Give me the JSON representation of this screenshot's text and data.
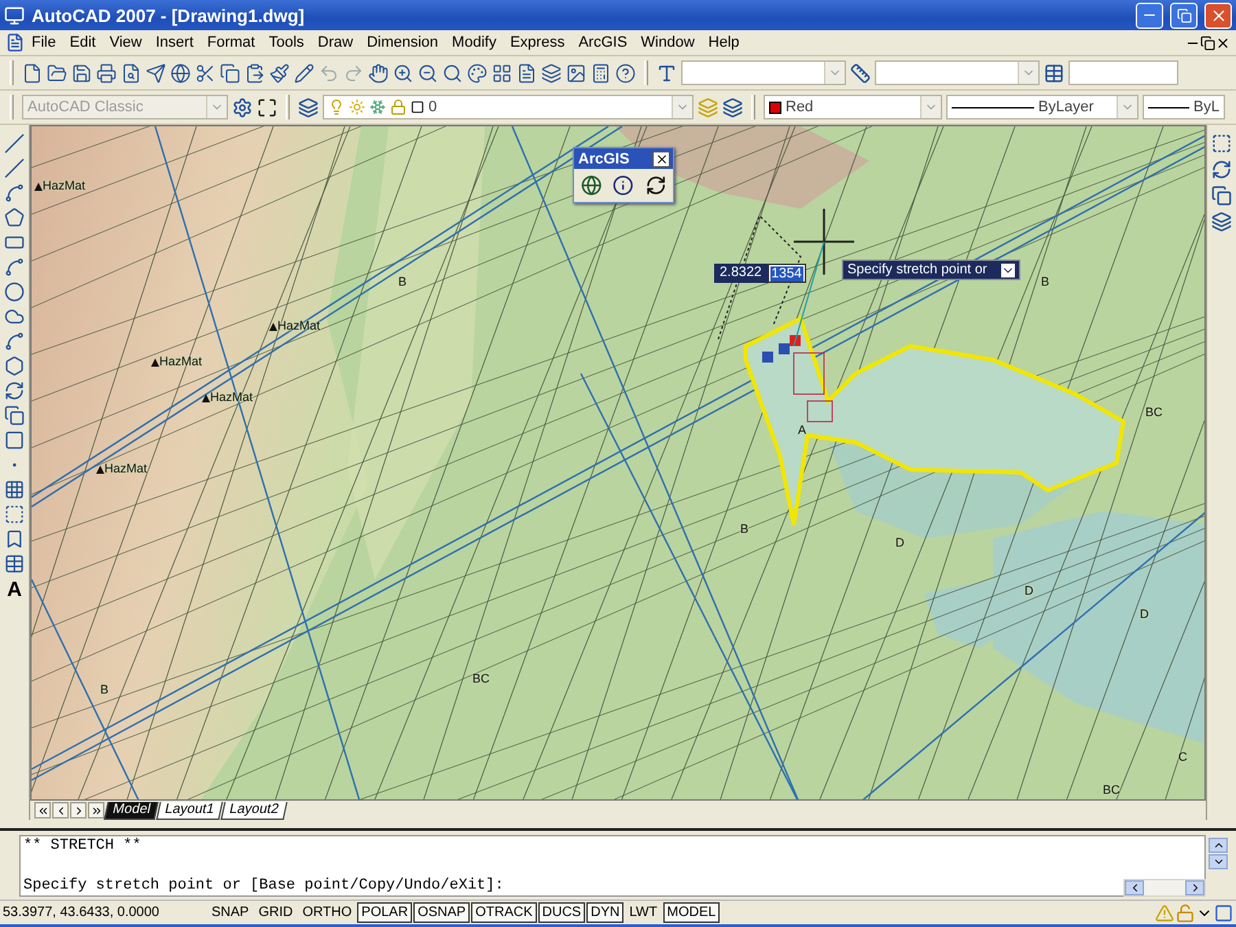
{
  "window": {
    "title": "AutoCAD 2007 - [Drawing1.dwg]"
  },
  "menu": [
    "File",
    "Edit",
    "View",
    "Insert",
    "Format",
    "Tools",
    "Draw",
    "Dimension",
    "Modify",
    "Express",
    "ArcGIS",
    "Window",
    "Help"
  ],
  "properties_toolbar": {
    "workspace": "AutoCAD Classic",
    "layer": "0",
    "color": {
      "label": "Red",
      "color": "#e00000"
    },
    "linetype": "ByLayer",
    "lineweight": "ByL"
  },
  "draw_toolbar": {
    "text_tool": "A"
  },
  "arcgis_toolbar": {
    "title": "ArcGIS"
  },
  "dynamic_input": {
    "distance": "2.8322",
    "angle": "1354",
    "prompt": "Specify stretch point or"
  },
  "map_labels": [
    "HazMat",
    "B",
    "B",
    "HazMat",
    "HazMat",
    "HazMat",
    "BC",
    "A",
    "HazMat",
    "B",
    "D",
    "D",
    "D",
    "BC",
    "B",
    "C",
    "BC"
  ],
  "layout_tabs": [
    {
      "label": "Model",
      "selected": true
    },
    {
      "label": "Layout1",
      "selected": false
    },
    {
      "label": "Layout2",
      "selected": false
    }
  ],
  "command_lines": [
    "** STRETCH **",
    "Specify stretch point or [Base point/Copy/Undo/eXit]:"
  ],
  "status_bar": {
    "coordinates": "53.3977, 43.6433, 0.0000",
    "toggles": [
      {
        "label": "SNAP",
        "on": false
      },
      {
        "label": "GRID",
        "on": false
      },
      {
        "label": "ORTHO",
        "on": false
      },
      {
        "label": "POLAR",
        "on": true
      },
      {
        "label": "OSNAP",
        "on": true
      },
      {
        "label": "OTRACK",
        "on": true
      },
      {
        "label": "DUCS",
        "on": true
      },
      {
        "label": "DYN",
        "on": true
      },
      {
        "label": "LWT",
        "on": false
      },
      {
        "label": "MODEL",
        "on": true
      }
    ]
  }
}
